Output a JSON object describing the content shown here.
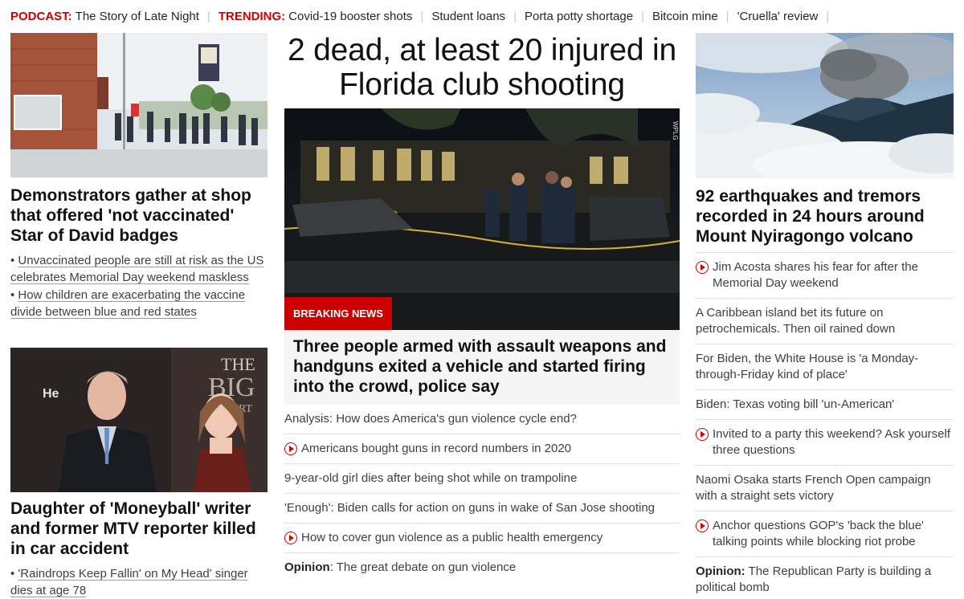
{
  "topbar": {
    "podcast_label": "PODCAST:",
    "podcast_link": "The Story of Late Night",
    "trending_label": "TRENDING:",
    "trending_links": [
      "Covid-19 booster shots",
      "Student loans",
      "Porta potty shortage",
      "Bitcoin mine",
      "'Cruella' review"
    ]
  },
  "left": {
    "story1": {
      "headline": "Demonstrators gather at shop that offered 'not vaccinated' Star of David badges",
      "bullets": [
        "Unvaccinated people are still at risk as the US celebrates Memorial Day weekend maskless",
        "How children are exacerbating the vaccine divide between blue and red states"
      ]
    },
    "story2": {
      "headline": "Daughter of 'Moneyball' writer and former MTV reporter killed in car accident",
      "bullets": [
        "'Raindrops Keep Fallin' on My Head' singer dies at age 78"
      ],
      "photo_backdrop_text": "THE BIG SHORT",
      "photo_backdrop_text2": "He"
    }
  },
  "middle": {
    "title": "2 dead, at least 20 injured in Florida club shooting",
    "badge": "BREAKING NEWS",
    "watermark": "WPLG",
    "lead": "Three people armed with assault weapons and handguns exited a vehicle and started firing into the crowd, police say",
    "items": [
      {
        "video": false,
        "prefix": "",
        "text": "Analysis: How does America's gun violence cycle end?"
      },
      {
        "video": true,
        "prefix": "",
        "text": "Americans bought guns in record numbers in 2020"
      },
      {
        "video": false,
        "prefix": "",
        "text": "9-year-old girl dies after being shot while on trampoline"
      },
      {
        "video": false,
        "prefix": "",
        "text": "'Enough': Biden calls for action on guns in wake of San Jose shooting"
      },
      {
        "video": true,
        "prefix": "",
        "text": "How to cover gun violence as a public health emergency"
      },
      {
        "video": false,
        "prefix": "Opinion",
        "text": ": The great debate on gun violence"
      }
    ]
  },
  "right": {
    "headline": "92 earthquakes and tremors recorded in 24 hours around Mount Nyiragongo volcano",
    "items": [
      {
        "video": true,
        "prefix": "",
        "text": "Jim Acosta shares his fear for after the Memorial Day weekend"
      },
      {
        "video": false,
        "prefix": "",
        "text": "A Caribbean island bet its future on petrochemicals. Then oil rained down"
      },
      {
        "video": false,
        "prefix": "",
        "text": "For Biden, the White House is 'a Monday-through-Friday kind of place'"
      },
      {
        "video": false,
        "prefix": "",
        "text": "Biden: Texas voting bill 'un-American'"
      },
      {
        "video": true,
        "prefix": "",
        "text": "Invited to a party this weekend? Ask yourself three questions"
      },
      {
        "video": false,
        "prefix": "",
        "text": "Naomi Osaka starts French Open campaign with a straight sets victory"
      },
      {
        "video": true,
        "prefix": "",
        "text": "Anchor questions GOP's 'back the blue' talking points while blocking riot probe"
      },
      {
        "video": false,
        "prefix": "Opinion:",
        "text": " The Republican Party is building a political bomb"
      }
    ]
  },
  "colors": {
    "accent": "#cc0000",
    "divider": "#e1e1e1",
    "lead_bg": "#f5f5f5"
  }
}
